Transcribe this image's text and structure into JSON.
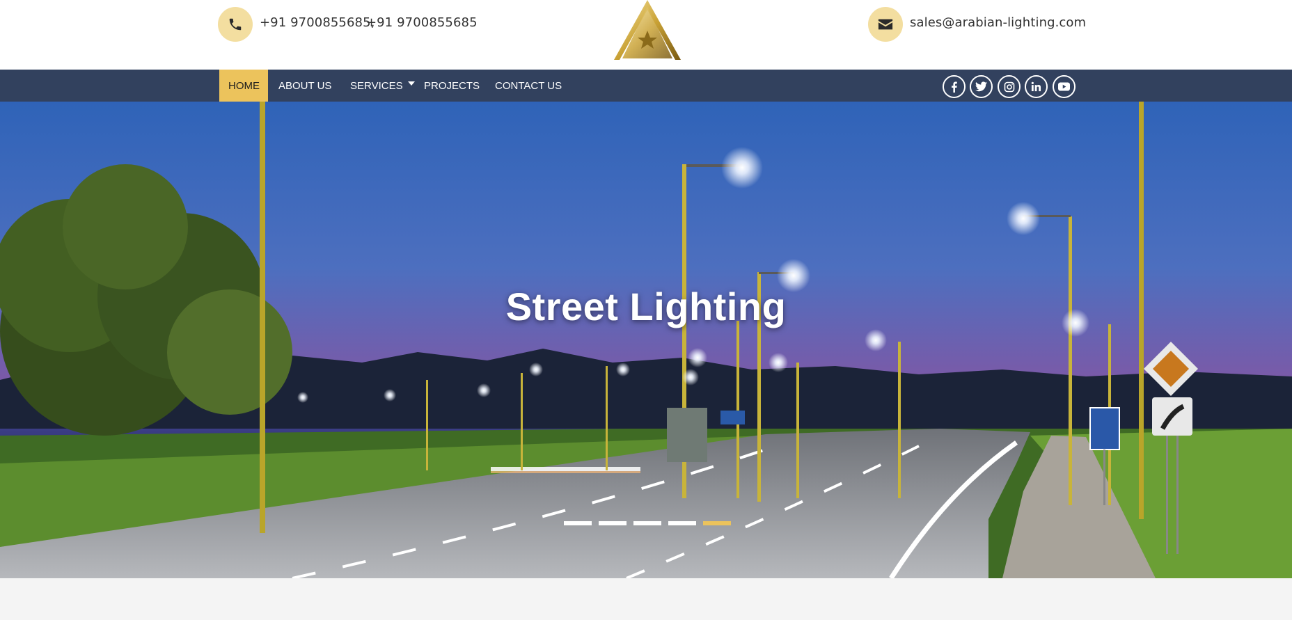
{
  "contact": {
    "phone1": "+91 9700855685,",
    "phone2": "+91 9700855685",
    "email": "sales@arabian-lighting.com",
    "phone_icon": "phone-icon",
    "mail_icon": "envelope-icon"
  },
  "logo": {
    "icon": "gold-a-star-logo"
  },
  "nav": {
    "items": [
      {
        "label": "HOME",
        "active": true
      },
      {
        "label": "ABOUT US"
      },
      {
        "label": "SERVICES",
        "has_dropdown": true
      },
      {
        "label": "PROJECTS"
      },
      {
        "label": "CONTACT US"
      }
    ]
  },
  "social": [
    "facebook-icon",
    "twitter-icon",
    "instagram-icon",
    "linkedin-icon",
    "youtube-icon"
  ],
  "hero": {
    "title": "Street Lighting",
    "slides_count": 5,
    "active_slide": 5
  },
  "colors": {
    "accent": "#ecc35c",
    "icon_bg": "#f3dea0",
    "navbar": "#32415e"
  }
}
